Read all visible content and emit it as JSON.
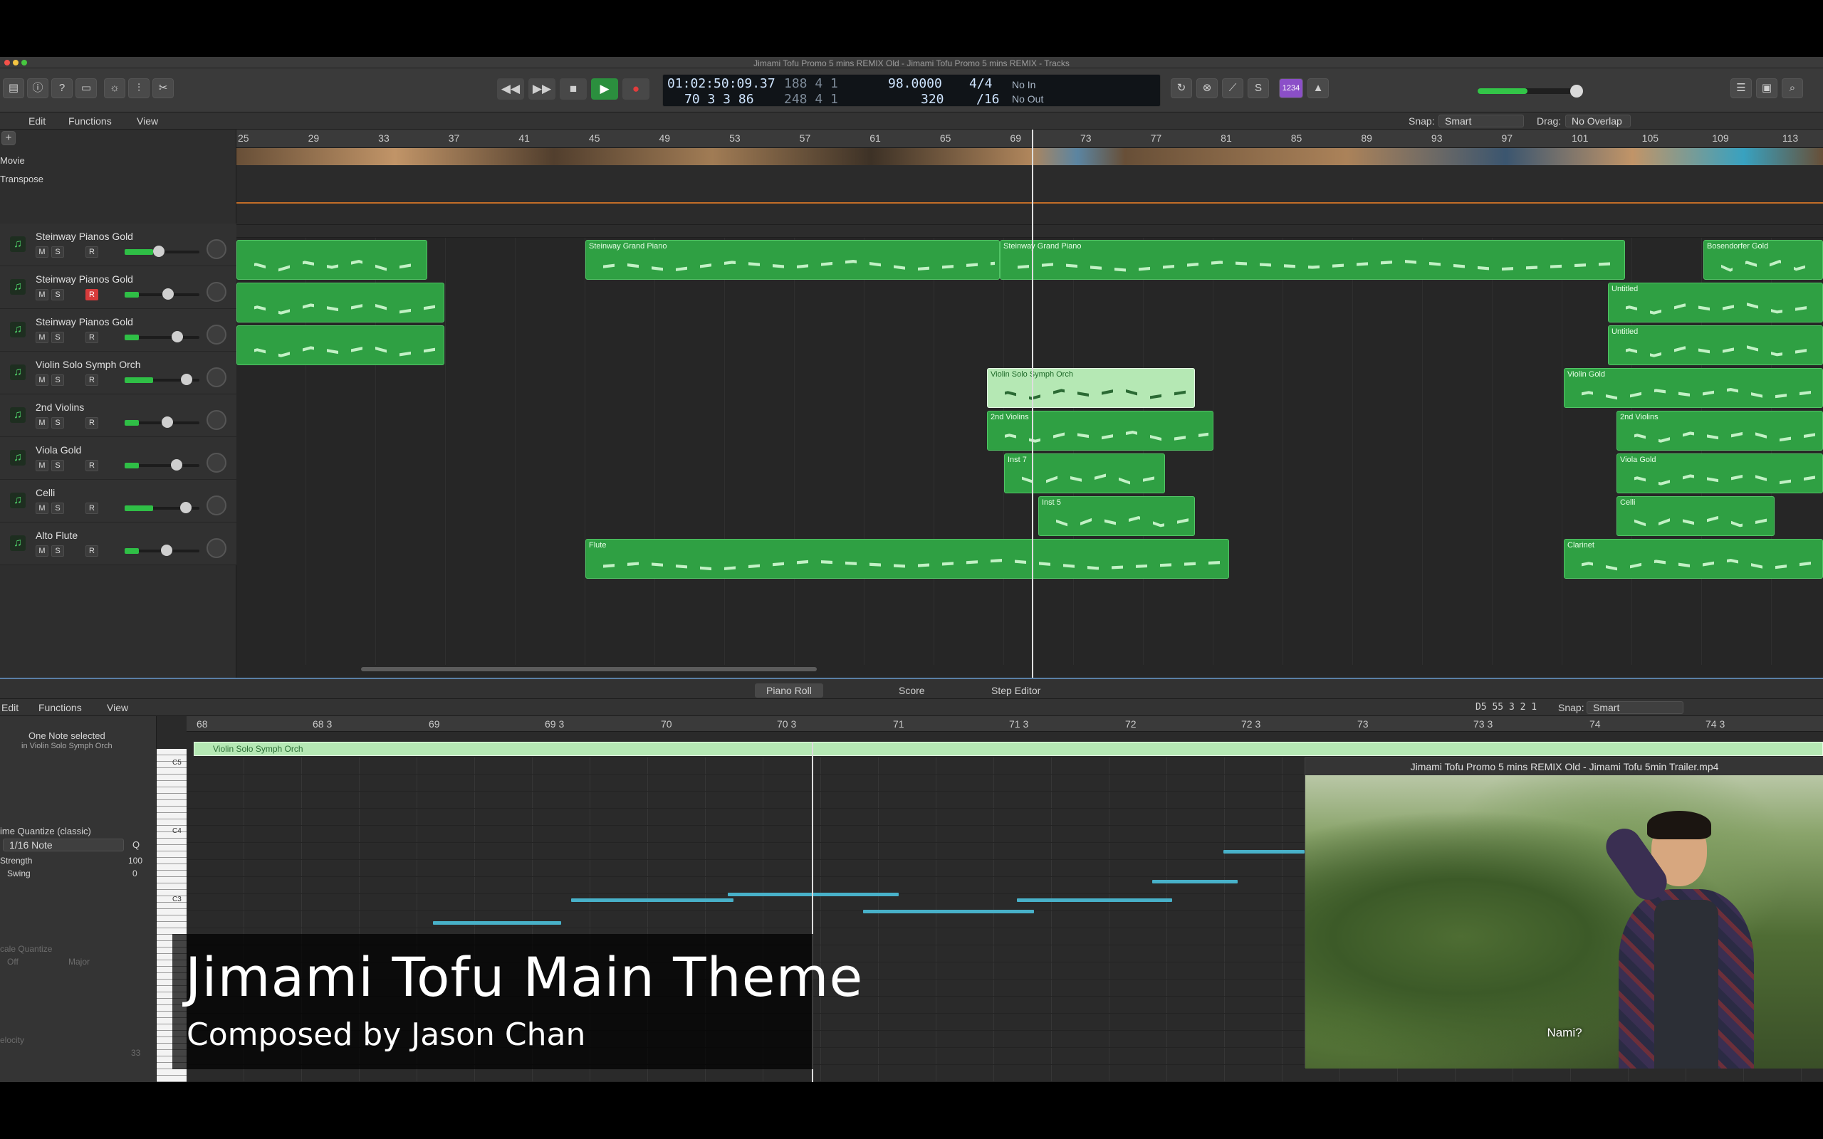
{
  "window": {
    "title": "Jimami Tofu Promo 5 mins REMIX Old - Jimami Tofu Promo 5 mins REMIX - Tracks"
  },
  "transport": {
    "time": "01:02:50:09.37",
    "bars": "70  3  3    86",
    "pos_a": "188  4  1",
    "pos_b": "248  4  1",
    "tempo": "98.0000",
    "tempo_b": "320",
    "signature": "4/4",
    "division": "/16",
    "in_label": "No In",
    "out_label": "No Out",
    "key_badge": "1234"
  },
  "tracks_bar": {
    "edit": "Edit",
    "functions": "Functions",
    "view": "View",
    "snap_label": "Snap:",
    "snap_value": "Smart",
    "drag_label": "Drag:",
    "drag_value": "No Overlap"
  },
  "global_tracks": {
    "movie": "Movie",
    "transpose": "Transpose"
  },
  "ruler": [
    "25",
    "29",
    "33",
    "37",
    "41",
    "45",
    "49",
    "53",
    "57",
    "61",
    "65",
    "69",
    "73",
    "77",
    "81",
    "85",
    "89",
    "93",
    "97",
    "101",
    "105",
    "109",
    "113"
  ],
  "tracks": [
    {
      "name": "Steinway Pianos Gold",
      "rec": false
    },
    {
      "name": "Steinway Pianos Gold",
      "rec": true
    },
    {
      "name": "Steinway Pianos Gold",
      "rec": false
    },
    {
      "name": "Violin Solo Symph Orch",
      "rec": false
    },
    {
      "name": "2nd Violins",
      "rec": false
    },
    {
      "name": "Viola Gold",
      "rec": false
    },
    {
      "name": "Celli",
      "rec": false
    },
    {
      "name": "Alto Flute",
      "rec": false
    }
  ],
  "buttons": {
    "mute": "M",
    "solo": "S",
    "rec": "R"
  },
  "regions": {
    "grand1": "Steinway Grand Piano",
    "grand2": "Steinway Grand Piano",
    "bosendorfer": "Bosendorfer Gold",
    "untitled1": "Untitled",
    "untitled2": "Untitled",
    "violin_solo": "Violin Solo Symph Orch",
    "violin_gold": "Violin Gold",
    "second_violins": "2nd Violins",
    "second_violins_r": "2nd Violins",
    "inst7": "Inst 7",
    "viola_gold": "Viola Gold",
    "inst5": "Inst 5",
    "celli": "Celli",
    "flute": "Flute",
    "clarinet": "Clarinet"
  },
  "editor_tabs": [
    "Piano Roll",
    "Score",
    "Step Editor"
  ],
  "editor_bar": {
    "edit": "Edit",
    "functions": "Functions",
    "view": "View",
    "position": "D5  55 3 2 1",
    "snap_label": "Snap:",
    "snap_value": "Smart"
  },
  "inspector": {
    "selected": "One Note selected",
    "selected_sub": "in Violin Solo Symph Orch",
    "quantize_label": "ime Quantize (classic)",
    "quantize_value": "1/16 Note",
    "q": "Q",
    "strength_label": "Strength",
    "strength_value": "100",
    "swing_label": "Swing",
    "swing_value": "0",
    "scale_label": "cale Quantize",
    "scale_off": "Off",
    "scale_major": "Major",
    "velocity_label": "elocity",
    "velocity_value": "33"
  },
  "piano_labels": [
    "C5",
    "C4",
    "C3"
  ],
  "pr_ruler": [
    "68",
    "68 3",
    "69",
    "69 3",
    "70",
    "70 3",
    "71",
    "71 3",
    "72",
    "72 3",
    "73",
    "73 3",
    "74",
    "74 3"
  ],
  "pr_region_name": "Violin Solo Symph Orch",
  "video": {
    "title": "Jimami Tofu Promo 5 mins REMIX Old - Jimami Tofu 5min Trailer.mp4",
    "subtitle": "Nami?"
  },
  "overlay": {
    "title": "Jimami Tofu Main Theme",
    "subtitle": "Composed by Jason Chan"
  },
  "colors": {
    "region": "#2fa043",
    "region_selected": "#b5e8b4",
    "note": "#48b1c9",
    "record": "#d63b3b",
    "play": "#33c548"
  }
}
